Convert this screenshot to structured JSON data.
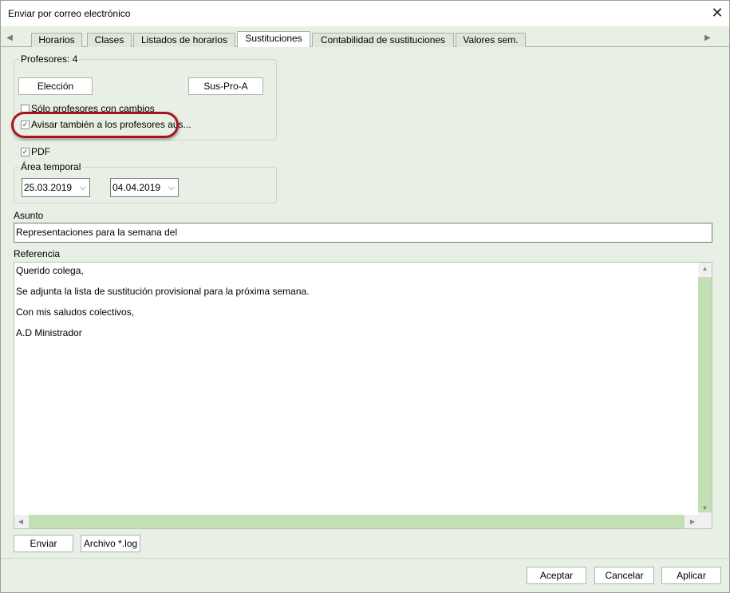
{
  "window": {
    "title": "Enviar por correo electrónico",
    "close_glyph": "✕"
  },
  "tabs": [
    {
      "label": "Horarios",
      "active": false
    },
    {
      "label": "Clases",
      "active": false
    },
    {
      "label": "Listados de horarios",
      "active": false
    },
    {
      "label": "Sustituciones",
      "active": true
    },
    {
      "label": "Contabilidad de sustituciones",
      "active": false
    },
    {
      "label": "Valores sem.",
      "active": false
    }
  ],
  "tab_nav": {
    "left": "◀",
    "right": "▶"
  },
  "profesores": {
    "group_label": "Profesores: 4",
    "eleccion_label": "Elección",
    "sus_pro_label": "Sus-Pro-A",
    "solo_cambios_label": "Sólo profesores con cambios",
    "solo_cambios_checked": false,
    "avisar_label": "Avisar también a los profesores aus...",
    "avisar_checked": true
  },
  "pdf": {
    "label": "PDF",
    "checked": true
  },
  "area_temporal": {
    "group_label": "Área temporal",
    "from_value": "25.03.2019",
    "to_value": "04.04.2019"
  },
  "asunto": {
    "label": "Asunto",
    "value": "Representaciones para la semana del"
  },
  "referencia": {
    "label": "Referencia",
    "lines": [
      "Querido colega,",
      "Se adjunta la lista de sustitución provisional para la próxima semana.",
      "Con mis saludos colectivos,",
      "A.D Ministrador"
    ]
  },
  "actions": {
    "enviar_label": "Enviar",
    "archivo_label": "Archivo *.log"
  },
  "footer": {
    "aceptar_label": "Aceptar",
    "cancelar_label": "Cancelar",
    "aplicar_label": "Aplicar"
  },
  "colors": {
    "highlight": "#a8151c",
    "scroll_thumb": "#c5dfb5",
    "window_bg": "#e8efe4"
  },
  "icons": {
    "check": "✓",
    "dropdown": "⌵",
    "scroll_up": "▲",
    "scroll_down": "▼",
    "scroll_left": "◀",
    "scroll_right": "▶"
  }
}
